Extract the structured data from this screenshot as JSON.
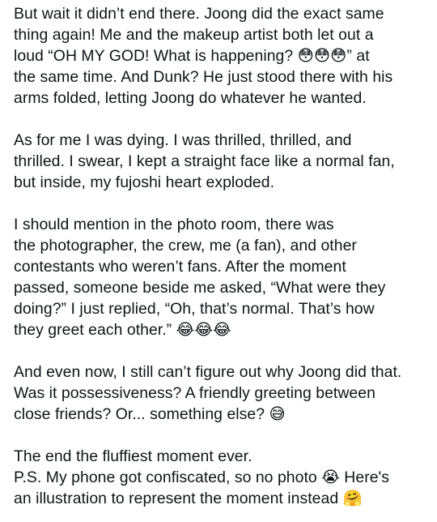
{
  "post": {
    "paragraphs": [
      "But wait  it didn’t end there. Joong did the exact same\nthing again! Me and the makeup artist both let out a\nloud “OH MY GOD! What is happening? 😳😳😳” at\nthe same time. And Dunk? He just stood there with his\narms folded, letting Joong do whatever he wanted.",
      "As for me I was dying. I was thrilled, thrilled, and\nthrilled. I swear, I kept a straight face like a normal fan,\nbut inside, my fujoshi heart exploded.",
      "I should mention in the photo room, there was\nthe photographer, the crew, me (a fan), and other\ncontestants who weren’t fans. After the moment\npassed, someone beside me asked, “What were they\ndoing?” I just replied, “Oh, that’s normal. That’s how\nthey greet each other.” 😂😂😂",
      "And even now, I still can’t figure out why Joong did that.\nWas it possessiveness? A friendly greeting between\nclose friends? Or... something else? 😅",
      "The end the fluffiest moment ever.\nP.S. My phone got confiscated, so no photo 😭 Here's\nan illustration to represent the moment instead 🤗"
    ]
  }
}
